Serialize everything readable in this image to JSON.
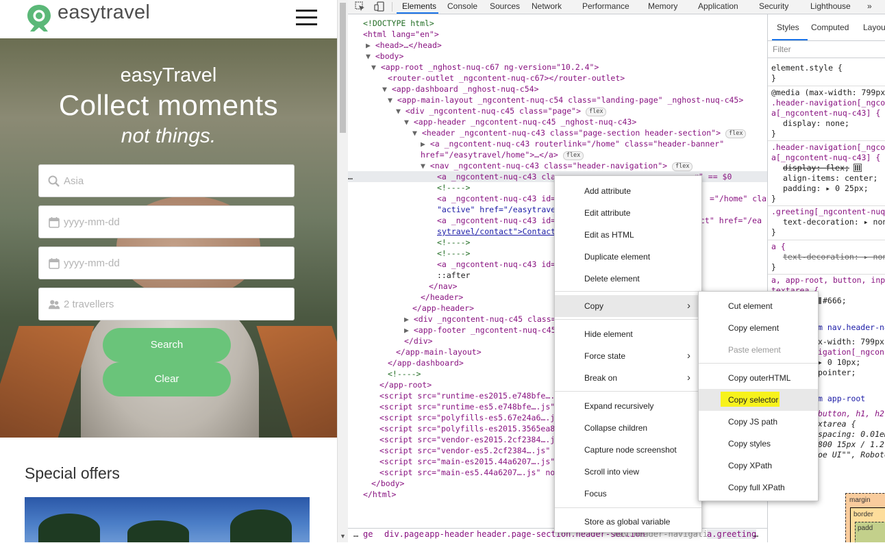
{
  "website": {
    "logo_text": "easytravel",
    "hero": {
      "tagline": "easyTravel",
      "title": "Collect moments",
      "subtitle": "not things."
    },
    "form": {
      "destination_placeholder": "Asia",
      "from_date_placeholder": "yyyy-mm-dd",
      "to_date_placeholder": "yyyy-mm-dd",
      "travellers_placeholder": "2 travellers",
      "search_label": "Search",
      "clear_label": "Clear"
    },
    "special_offers_title": "Special offers"
  },
  "devtools": {
    "tabs": [
      "Elements",
      "Console",
      "Sources",
      "Network",
      "Performance",
      "Memory",
      "Application",
      "Security",
      "Lighthouse",
      "»"
    ],
    "active_tab": "Elements",
    "breadcrumb": [
      "…",
      "ge",
      "div.page",
      "app-header",
      "header.page-section.header-section",
      "nav.header-navigation",
      "a.greeting",
      "…"
    ],
    "styles_tabs": [
      "Styles",
      "Computed",
      "Layout"
    ],
    "styles_filter_placeholder": "Filter",
    "dom_lines": [
      "<!DOCTYPE html>",
      "<html lang=\"en\">",
      "<head>…</head>",
      "<body>",
      "<app-root _nghost-nuq-c67 ng-version=\"10.2.4\">",
      "<router-outlet _ngcontent-nuq-c67></router-outlet>",
      "<app-dashboard _nghost-nuq-c54>",
      "<app-main-layout _ngcontent-nuq-c54 class=\"landing-page\" _nghost-nuq-c45>",
      "<div _ngcontent-nuq-c45 class=\"page\">",
      "<app-header _ngcontent-nuq-c45 _nghost-nuq-c43>",
      "<header _ngcontent-nuq-c43 class=\"page-section header-section\">",
      "<a _ngcontent-nuq-c43 routerlink=\"/home\" class=\"header-banner\" href=\"/easytravel/home\">…</a>",
      "<nav _ngcontent-nuq-c43 class=\"header-navigation\">",
      "<a _ngcontent-nuq-c43 cla",
      "<!---->",
      "<a _ngcontent-nuq-c43 id=\"",
      "\"active\" href=\"/easytravel",
      "<a _ngcontent-nuq-c43 id=\"",
      "sytravel/contact\">Contact<",
      "<!---->",
      "<!---->",
      "<a _ngcontent-nuq-c43 id=\"",
      "::after",
      "</nav>",
      "</header>",
      "</app-header>",
      "<div _ngcontent-nuq-c45 class=\"",
      "<app-footer _ngcontent-nuq-c45",
      "</div>",
      "</app-main-layout>",
      "</app-dashboard>",
      "<!---->",
      "</app-root>",
      "<script src=\"runtime-es2015.e748bfe….js",
      "<script src=\"runtime-es5.e748bfe….js\"",
      "<script src=\"polyfills-es5.67e24a6….js",
      "<script src=\"polyfills-es2015.3565ea8…",
      "<script src=\"vendor-es2015.2cf2384….js",
      "<script src=\"vendor-es5.2cf2384….js\" no",
      "<script src=\"main-es2015.44a6207….js\" t",
      "<script src=\"main-es5.44a6207….js\" nomo",
      "</body>",
      "</html>"
    ],
    "dom_fragments": {
      "nav_active_a_right": "r\" == $0",
      "home_href_right": "=\"/home\" class=",
      "contact_href_right": "ct\" href=\"/ea"
    },
    "styles_lines": [
      "element.style {",
      "}",
      "@media (max-width: 799px)",
      ".header-navigation[_ngcon",
      "a[_ngcontent-nuq-c43] {",
      "display: none;",
      "}",
      ".header-navigation[_ngcon",
      "a[_ngcontent-nuq-c43] {",
      "display: flex;",
      "align-items: center;",
      "padding: ▸ 0 25px;",
      "}",
      ".greeting[_ngcontent-nuq-c",
      "text-decoration: ▸ none;",
      "}",
      "a {",
      "text-decoration: ▸ none;",
      "}",
      "a, app-root, button, input",
      "textarea {",
      "#666;",
      "m nav.header-na",
      "x-width: 799px)",
      "igation[_ngcon",
      "▸ 0 10px;",
      "pointer;",
      "m app-root",
      "button, h1, h2,",
      "xtarea {",
      "spacing: 0.01em;",
      "800 15px / 1.2 -",
      "oe UI\"\", Roboto",
      "margin",
      "border",
      "padd"
    ],
    "context_menu": {
      "items": [
        "Add attribute",
        "Edit attribute",
        "Edit as HTML",
        "Duplicate element",
        "Delete element",
        "Copy",
        "Hide element",
        "Force state",
        "Break on",
        "Expand recursively",
        "Collapse children",
        "Capture node screenshot",
        "Scroll into view",
        "Focus",
        "Store as global variable"
      ],
      "submenu": [
        "Cut element",
        "Copy element",
        "Paste element",
        "Copy outerHTML",
        "Copy selector",
        "Copy JS path",
        "Copy styles",
        "Copy XPath",
        "Copy full XPath"
      ],
      "highlighted": "Copy selector",
      "highlight_color": "#f7f21c"
    },
    "badge_flex": "flex",
    "ellipsis": "…",
    "dollar_zero": "== $0"
  },
  "colors": {
    "brand_green": "#6ac47a",
    "tag": "#881280",
    "attr": "#994500",
    "value": "#1a1aa6",
    "comment": "#236e25"
  }
}
